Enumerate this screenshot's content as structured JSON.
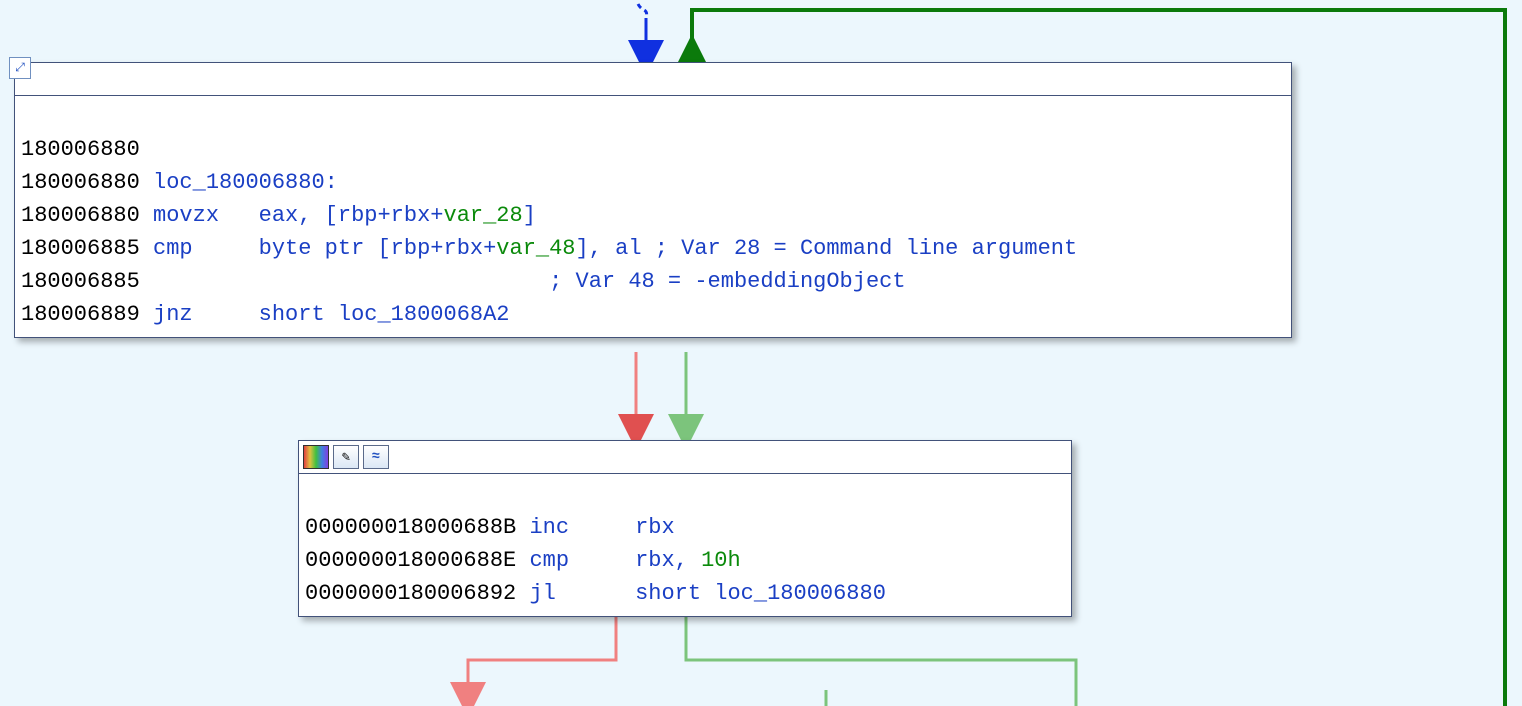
{
  "block1": {
    "addr0": "180006880",
    "label_line_addr": "180006880",
    "label": "loc_180006880:",
    "line0": {
      "addr": "180006880",
      "mnem": "movzx",
      "op": "eax, [rbp+rbx+",
      "var": "var_28",
      "tail": "]"
    },
    "line1": {
      "addr": "180006885",
      "mnem": "cmp",
      "op": "byte ptr [rbp+rbx+",
      "var": "var_48",
      "tail": "], al",
      "comment": "; Var 28 = Command line argument"
    },
    "line2": {
      "addr": "180006885",
      "comment": "; Var 48 = -embeddingObject"
    },
    "line3": {
      "addr": "180006889",
      "mnem": "jnz",
      "op": "short loc_1800068A2"
    }
  },
  "block2": {
    "line0": {
      "addr": "000000018000688B",
      "mnem": "inc",
      "op": "rbx"
    },
    "line1": {
      "addr": "000000018000688E",
      "mnem": "cmp",
      "op": "rbx, ",
      "imm": "10h"
    },
    "line2": {
      "addr": "0000000180006892",
      "mnem": "jl",
      "op": "short loc_180006880"
    }
  }
}
